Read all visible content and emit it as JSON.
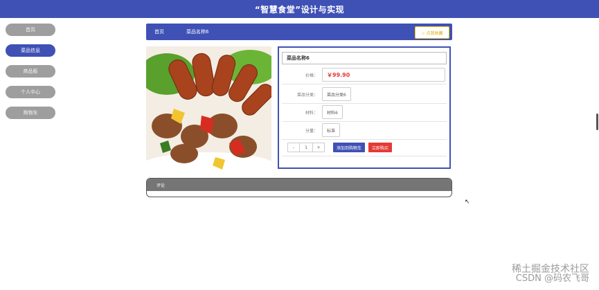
{
  "header": {
    "title": "“智慧食堂”设计与实现"
  },
  "sidebar": {
    "items": [
      {
        "label": "首页"
      },
      {
        "label": "菜品信息"
      },
      {
        "label": "商品板"
      },
      {
        "label": "个人中心"
      },
      {
        "label": "购物车"
      }
    ]
  },
  "breadcrumb": {
    "items": [
      "首页",
      "菜品名称6"
    ],
    "collect_label": "☆ 点我收藏"
  },
  "product": {
    "name": "菜品名称6",
    "price_label": "价格：",
    "price": "￥99.90",
    "category_label": "菜品分类：",
    "category": "菜品分类6",
    "material_label": "材料：",
    "material": "材料6",
    "portion_label": "分量：",
    "portion": "标准",
    "qty_minus": "-",
    "qty_value": "1",
    "qty_plus": "+",
    "add_cart_label": "添加到购物车",
    "buy_now_label": "立即购买"
  },
  "review": {
    "title": "评论"
  },
  "watermark": {
    "line1": "稀土掘金技术社区",
    "line2": "CSDN @码农飞哥"
  },
  "colors": {
    "primary": "#3f51b5",
    "price": "#e53935",
    "buy": "#e53935",
    "collect": "#f1c40f"
  }
}
